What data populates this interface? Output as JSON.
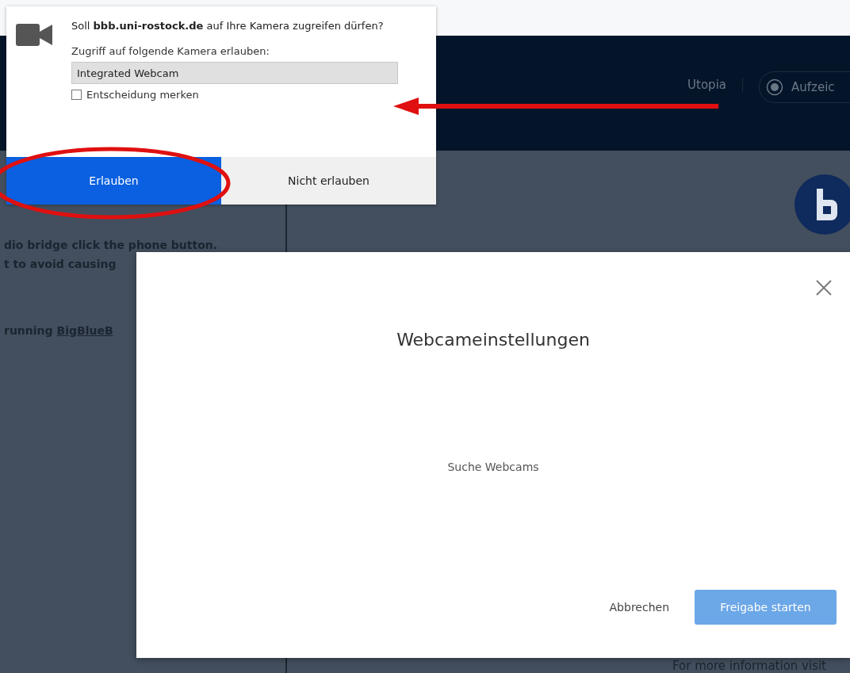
{
  "permission_popup": {
    "message": "Soll **bbb.uni-rostock.de** auf Ihre Kamera zugreifen dürfen?",
    "camera_label": "Zugriff auf folgende Kamera erlauben:",
    "camera_select": {
      "value": "Integrated Webcam"
    },
    "remember": {
      "label": "Entscheidung merken",
      "checked": false
    },
    "buttons": [
      {
        "label": "Erlauben",
        "kind": "primary"
      },
      {
        "label": "Nicht erlauben",
        "kind": "secondary"
      }
    ]
  },
  "header": {
    "title": "Utopia",
    "record_button": {
      "label": "Aufzeic"
    }
  },
  "sidebar": {
    "lines": [
      {
        "text": "dio bridge click the phone button."
      },
      {
        "text": "t to avoid causing"
      },
      {
        "text": "running ",
        "link": "BigBlueB"
      }
    ]
  },
  "main": {
    "footer_text": "For more information visit"
  },
  "modal": {
    "title": "Webcameinstellungen",
    "status": "Suche Webcams",
    "buttons": [
      {
        "label": "Abbrechen",
        "kind": "text",
        "disabled": false
      },
      {
        "label": "Freigabe starten",
        "kind": "primary",
        "disabled": true
      }
    ]
  }
}
